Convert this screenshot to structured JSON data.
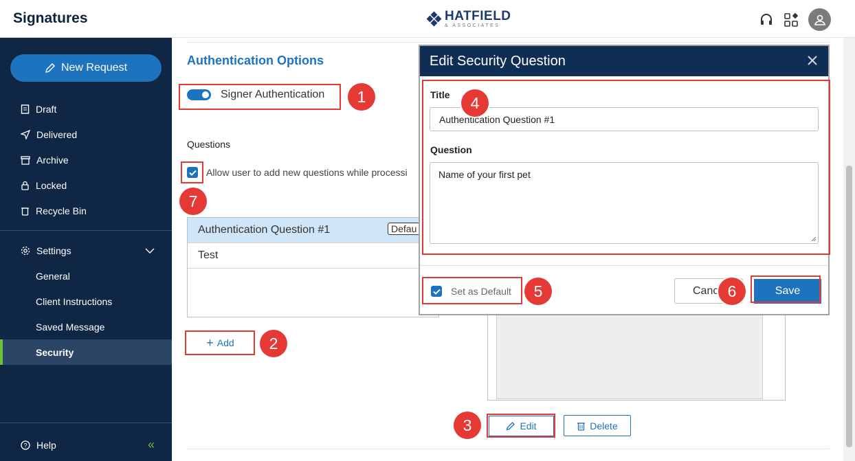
{
  "header": {
    "app_title": "Signatures",
    "logo_main": "HATFIELD",
    "logo_sub": "& ASSOCIATES"
  },
  "sidebar": {
    "new_request": "New Request",
    "items": [
      {
        "label": "Draft",
        "icon": "document-icon"
      },
      {
        "label": "Delivered",
        "icon": "send-icon"
      },
      {
        "label": "Archive",
        "icon": "archive-icon"
      },
      {
        "label": "Locked",
        "icon": "lock-icon"
      },
      {
        "label": "Recycle Bin",
        "icon": "trash-icon"
      }
    ],
    "settings": {
      "label": "Settings",
      "sub": [
        "General",
        "Client Instructions",
        "Saved Message",
        "Security"
      ],
      "active": "Security"
    },
    "help": "Help"
  },
  "main": {
    "section_title": "Authentication Options",
    "signer_auth_label": "Signer Authentication",
    "questions_label": "Questions",
    "allow_label": "Allow user to add new questions while processi",
    "questions": [
      {
        "title": "Authentication Question #1",
        "tag": "Defau"
      },
      {
        "title": "Test"
      }
    ],
    "add_label": "Add",
    "edit_label": "Edit",
    "delete_label": "Delete"
  },
  "modal": {
    "title": "Edit Security Question",
    "title_label": "Title",
    "title_value": "Authentication Question #1",
    "question_label": "Question",
    "question_value": "Name of your first pet",
    "set_default_label": "Set as Default",
    "cancel_label": "Cancel",
    "save_label": "Save"
  },
  "annotations": [
    "1",
    "2",
    "3",
    "4",
    "5",
    "6",
    "7"
  ],
  "colors": {
    "sidebar_bg": "#0f2744",
    "accent": "#1e73be",
    "active_marker": "#6cbf3f",
    "annotation": "#e53935",
    "modal_header": "#0f2d55"
  }
}
